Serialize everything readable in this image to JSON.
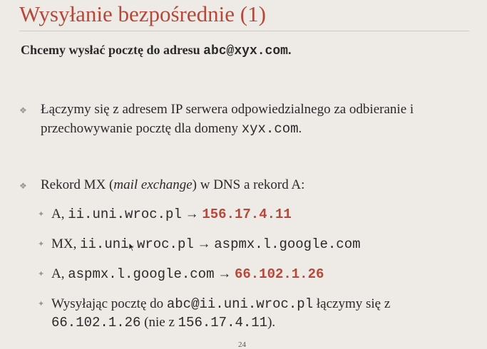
{
  "slide": {
    "title": "Wysyłanie bezpośrednie (1)",
    "subtitle_prefix": "Chcemy wysłać pocztę do adresu ",
    "subtitle_email": "abc@xyx.com",
    "subtitle_suffix": ".",
    "bullet1": {
      "text_a": "Łączymy się z adresem IP serwera odpowiedzialnego za odbieranie i przechowywanie pocztę dla domeny ",
      "domain": "xyx.com",
      "text_b": "."
    },
    "bullet2": {
      "text_a": "Rekord MX (",
      "italic": "mail exchange",
      "text_b": ") w DNS a rekord A:"
    },
    "sub1": {
      "prefix": "A, ",
      "host": "ii.uni.wroc.pl",
      "arrow": " → ",
      "ip": "156.17.4.11"
    },
    "sub2": {
      "prefix": "MX, ",
      "host": "ii.uni.wroc.pl",
      "arrow": " → ",
      "target": "aspmx.l.google.com"
    },
    "sub3": {
      "prefix": "A, ",
      "host": "aspmx.l.google.com",
      "arrow": " → ",
      "ip": "66.102.1.26"
    },
    "sub4": {
      "text_a": "Wysyłając pocztę do ",
      "email": "abc@ii.uni.wroc.pl",
      "text_b": " łączymy się z",
      "ip1": "66.102.1.26",
      "text_c": " (nie z ",
      "ip2": "156.17.4.11",
      "text_d": ")."
    },
    "page_number": "24",
    "bullet_glyph": "❖",
    "sub_bullet_glyph": "✦"
  }
}
